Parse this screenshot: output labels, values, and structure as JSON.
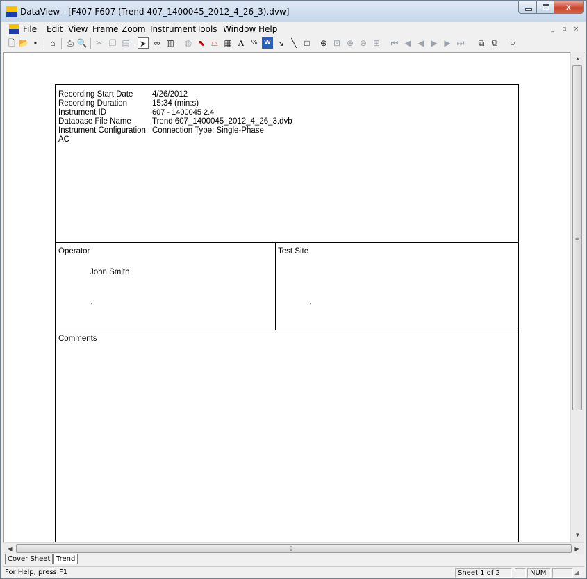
{
  "window": {
    "title": "DataView - [F407 F607 (Trend 407_1400045_2012_4_26_3).dvw]",
    "close_label": "x"
  },
  "menu": {
    "items": [
      "File",
      "Edit",
      "View",
      "Frame",
      "Zoom",
      "Instrument",
      "Tools",
      "Window",
      "Help"
    ],
    "mdi_minimize": "_",
    "mdi_restore": "▫",
    "mdi_close": "×"
  },
  "toolbar": {
    "icons": [
      "new-icon",
      "open-icon",
      "save-icon",
      "home-icon",
      "print-icon",
      "print-preview-icon",
      "cut-icon",
      "copy-icon",
      "paste-icon",
      "pointer-icon",
      "glasses-icon",
      "frame-icon",
      "disabled-icon",
      "select-icon",
      "line-graph-icon",
      "table-icon",
      "text-icon",
      "label-icon",
      "word-icon",
      "arrow-icon",
      "line-icon",
      "rectangle-icon",
      "zoom-in-icon",
      "zoom-region-icon",
      "zoom-plus-icon",
      "zoom-minus-icon",
      "zoom-fit-icon",
      "first-icon",
      "prev-page-icon",
      "prev-icon",
      "next-icon",
      "next-page-icon",
      "last-icon",
      "bring-front-icon",
      "send-back-icon",
      "circle-icon"
    ]
  },
  "report": {
    "fields": [
      {
        "label": "Recording Start Date",
        "value": "4/26/2012"
      },
      {
        "label": "Recording Duration",
        "value": "15:34 (min:s)"
      },
      {
        "label": "Instrument ID",
        "value": "607   - 1400045 2.4"
      },
      {
        "label": "Database File Name",
        "value": "Trend 607_1400045_2012_4_26_3.dvb"
      },
      {
        "label": "Instrument Configuration",
        "value": "Connection Type: Single-Phase"
      }
    ],
    "ac_label": "AC",
    "operator_label": "Operator",
    "operator_name": "John Smith",
    "operator_mark": ",",
    "test_site_label": "Test Site",
    "test_site_mark": ",",
    "comments_label": "Comments"
  },
  "tabs": [
    "Cover Sheet",
    "Trend"
  ],
  "status": {
    "help_text": "For Help, press F1",
    "sheet": "Sheet 1 of 2",
    "num": "NUM"
  },
  "colors": {
    "accent_titlebar": "#c5d6ea",
    "close_button": "#c8442b"
  }
}
